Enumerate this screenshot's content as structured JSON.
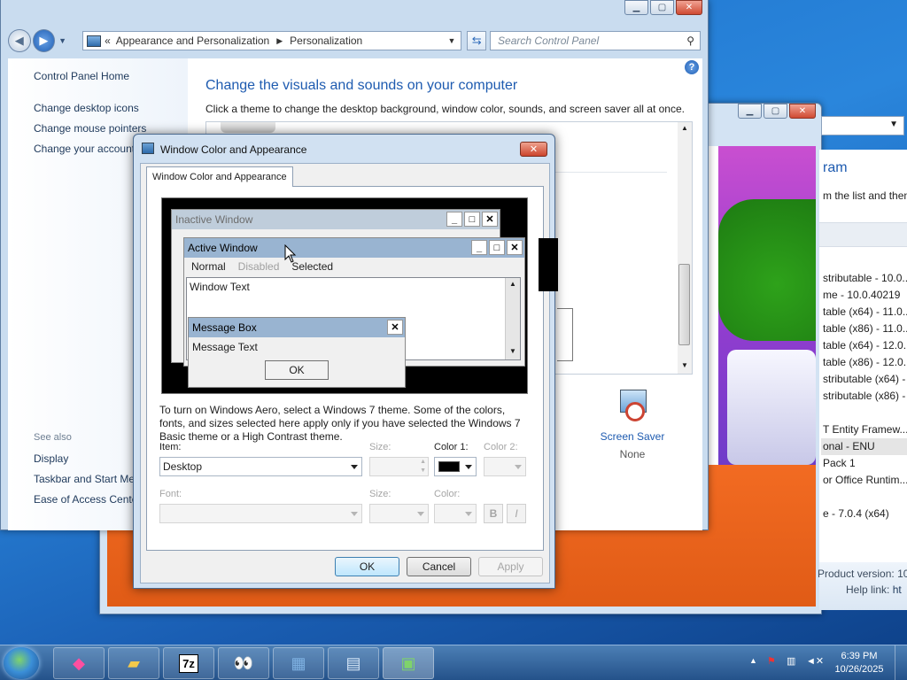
{
  "control_panel": {
    "breadcrumb_sep": "«",
    "breadcrumb": [
      "Appearance and Personalization",
      "Personalization"
    ],
    "search_placeholder": "Search Control Panel",
    "left_nav": {
      "home": "Control Panel Home",
      "links": [
        "Change desktop icons",
        "Change mouse pointers",
        "Change your account"
      ],
      "see_also_label": "See also",
      "see_also": [
        "Display",
        "Taskbar and Start Menu",
        "Ease of Access Center"
      ]
    },
    "title": "Change the visuals and sounds on your computer",
    "subtitle": "Click a theme to change the desktop background, window color, sounds, and screen saver all at once.",
    "screen_saver": {
      "label": "Screen Saver",
      "value": "None"
    }
  },
  "programs_window": {
    "heading_fragment": "ram",
    "instruction_fragment": "m the list and then",
    "rows": [
      "stributable - 10.0...",
      "me - 10.0.40219",
      "table (x64) - 11.0...",
      "table (x86) - 11.0...",
      "table (x64) - 12.0...",
      "table (x86) - 12.0...",
      "stributable (x64) - ...",
      "stributable (x86) - ...",
      "",
      "T Entity Framew...",
      "onal - ENU",
      "Pack 1",
      "or Office Runtim...",
      "",
      "e - 7.0.4 (x64)"
    ],
    "product_version_label": "Product version:",
    "product_version": "10",
    "help_link_label": "Help link:",
    "help_link": "ht"
  },
  "dialog": {
    "title": "Window Color and Appearance",
    "tab": "Window Color and Appearance",
    "preview": {
      "inactive_title": "Inactive Window",
      "active_title": "Active Window",
      "menu": {
        "normal": "Normal",
        "disabled": "Disabled",
        "selected": "Selected"
      },
      "window_text": "Window Text",
      "message_box_title": "Message Box",
      "message_text": "Message Text",
      "ok": "OK"
    },
    "info": "To turn on Windows Aero, select a Windows 7 theme.  Some of the colors, fonts, and sizes selected here apply only if you have selected the Windows 7 Basic theme or a High Contrast theme.",
    "item_label": "Item:",
    "item_value": "Desktop",
    "size_label": "Size:",
    "color1_label": "Color 1:",
    "color1_value": "#000000",
    "color2_label": "Color 2:",
    "font_label": "Font:",
    "font_size_label": "Size:",
    "font_color_label": "Color:",
    "bold": "B",
    "italic": "I",
    "buttons": {
      "ok": "OK",
      "cancel": "Cancel",
      "apply": "Apply"
    }
  },
  "taskbar": {
    "time": "6:39 PM",
    "date": "10/26/2025",
    "app7zip": "7z"
  }
}
